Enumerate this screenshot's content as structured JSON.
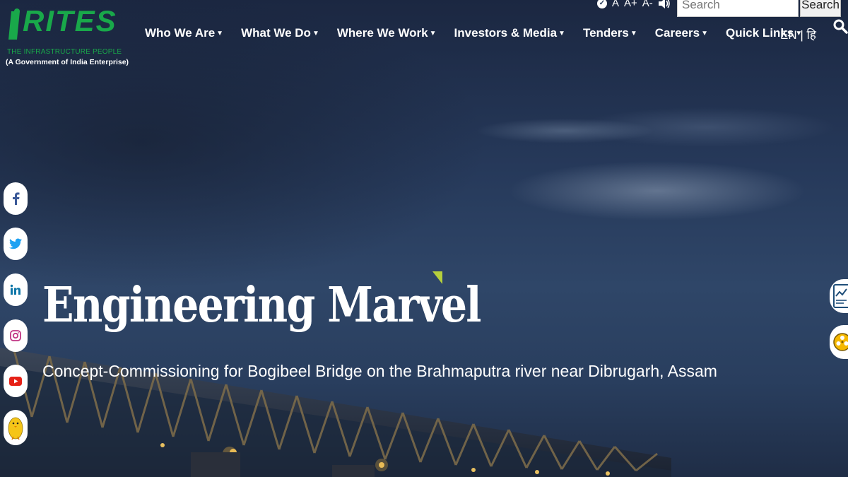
{
  "logo": {
    "brand": "RITES",
    "tagline": "THE INFRASTRUCTURE PEOPLE",
    "government": "(A Government of India Enterprise)"
  },
  "nav": {
    "items": [
      {
        "label": "Who We Are"
      },
      {
        "label": "What We Do"
      },
      {
        "label": "Where We Work"
      },
      {
        "label": "Investors & Media"
      },
      {
        "label": "Tenders"
      },
      {
        "label": "Careers"
      },
      {
        "label": "Quick Links"
      }
    ]
  },
  "accessibility": {
    "font_normal": "A",
    "font_increase": "A+",
    "font_decrease": "A-"
  },
  "search": {
    "placeholder": "Search",
    "button_label": "Search"
  },
  "language": {
    "current": "EN",
    "separator": "|",
    "alternate": "हि"
  },
  "hero": {
    "title": "Engineering Marvel",
    "subtitle": "Concept-Commissioning for Bogibeel Bridge on the Brahmaputra river near Dibrugarh, Assam"
  },
  "social": [
    {
      "icon": "facebook-icon"
    },
    {
      "icon": "twitter-icon"
    },
    {
      "icon": "linkedin-icon"
    },
    {
      "icon": "instagram-icon"
    },
    {
      "icon": "youtube-icon"
    },
    {
      "icon": "koo-icon"
    }
  ],
  "colors": {
    "brand_green": "#19a84a",
    "sky_dark": "#1b2741",
    "accent_lime": "#b5cf3c"
  }
}
